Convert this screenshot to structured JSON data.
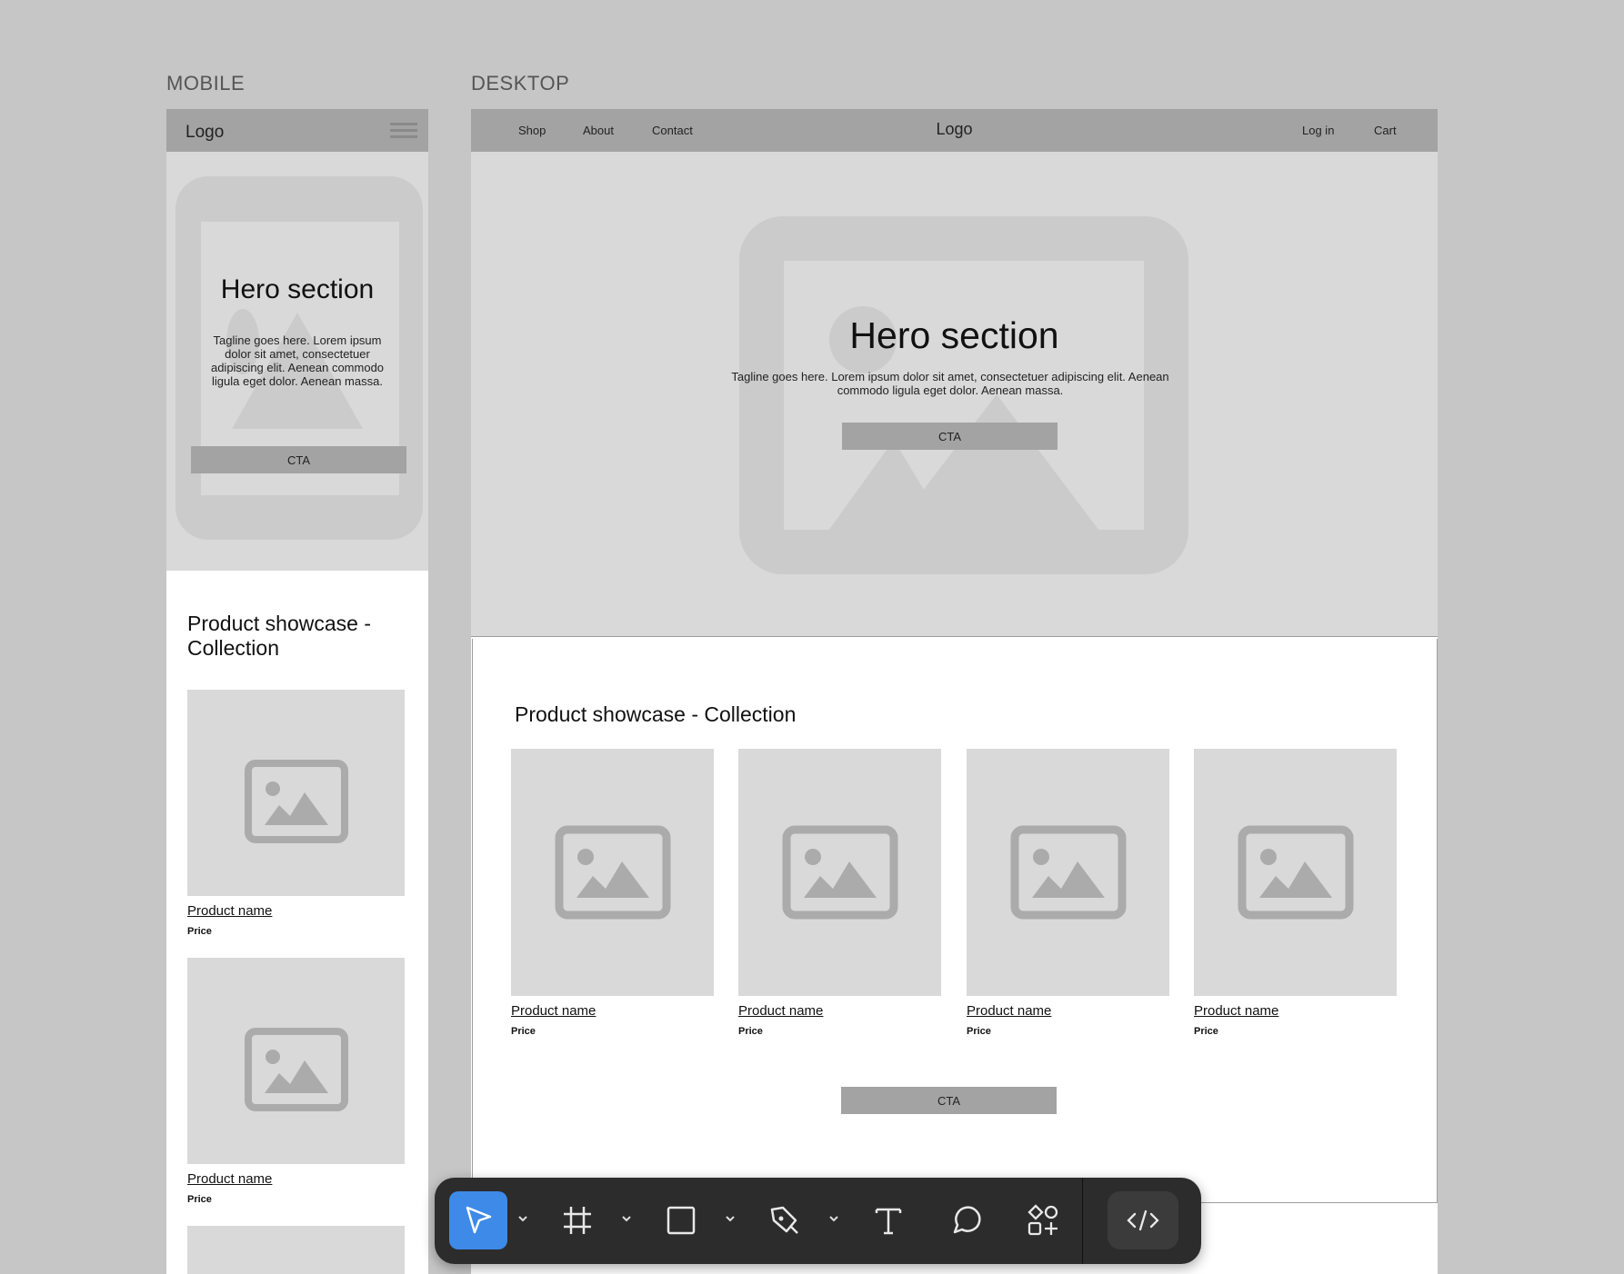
{
  "canvas": {
    "mobile_label": "MOBILE",
    "desktop_label": "DESKTOP"
  },
  "mobile": {
    "logo": "Logo",
    "hero": {
      "title": "Hero section",
      "tagline": "Tagline goes here. Lorem ipsum dolor sit amet, consectetuer adipiscing elit. Aenean commodo ligula eget dolor. Aenean massa.",
      "cta": "CTA"
    },
    "showcase": {
      "title": "Product showcase - Collection",
      "products": [
        {
          "name": "Product name",
          "price": "Price"
        },
        {
          "name": "Product name",
          "price": "Price"
        }
      ]
    }
  },
  "desktop": {
    "nav": {
      "left_links": [
        "Shop",
        "About",
        "Contact"
      ],
      "logo": "Logo",
      "login": "Log in",
      "cart": "Cart"
    },
    "hero": {
      "title": "Hero section",
      "tagline": "Tagline goes here. Lorem ipsum dolor sit amet, consectetuer adipiscing elit. Aenean commodo ligula eget dolor. Aenean massa.",
      "cta": "CTA"
    },
    "showcase": {
      "title": "Product showcase - Collection",
      "products": [
        {
          "name": "Product name",
          "price": "Price"
        },
        {
          "name": "Product name",
          "price": "Price"
        },
        {
          "name": "Product name",
          "price": "Price"
        },
        {
          "name": "Product name",
          "price": "Price"
        }
      ],
      "cta": "CTA"
    }
  },
  "toolbar": {
    "tools": [
      {
        "icon": "move-cursor-icon",
        "active": true
      },
      {
        "icon": "frame-icon",
        "active": false
      },
      {
        "icon": "rectangle-icon",
        "active": false
      },
      {
        "icon": "pen-icon",
        "active": false
      },
      {
        "icon": "text-icon",
        "active": false
      },
      {
        "icon": "comment-icon",
        "active": false
      },
      {
        "icon": "actions-icon",
        "active": false
      },
      {
        "icon": "dev-mode-icon",
        "active": false
      }
    ],
    "accent_color": "#3d8ae8"
  },
  "colors": {
    "canvas_bg": "#c6c6c6",
    "placeholder": "#d9d9d9",
    "navbar": "#a3a3a3",
    "toolbar_bg": "#2c2c2c"
  }
}
